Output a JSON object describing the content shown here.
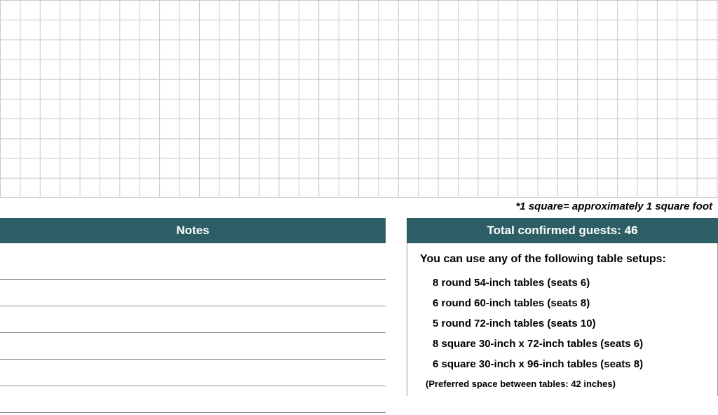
{
  "grid": {
    "legend": "*1 square= approximately 1 square foot"
  },
  "notes": {
    "header": "Notes"
  },
  "guests": {
    "header": "Total confirmed guests: 46",
    "confirmed_count": 46,
    "intro": "You can use any of the following table setups:",
    "setups": [
      "8 round 54-inch tables (seats 6)",
      "6 round 60-inch tables (seats 8)",
      "5 round 72-inch tables (seats 10)",
      "8 square 30-inch x 72-inch tables (seats 6)",
      "6 square 30-inch x 96-inch tables (seats 8)"
    ],
    "preferred_spacing": "(Preferred space between tables: 42 inches)"
  }
}
